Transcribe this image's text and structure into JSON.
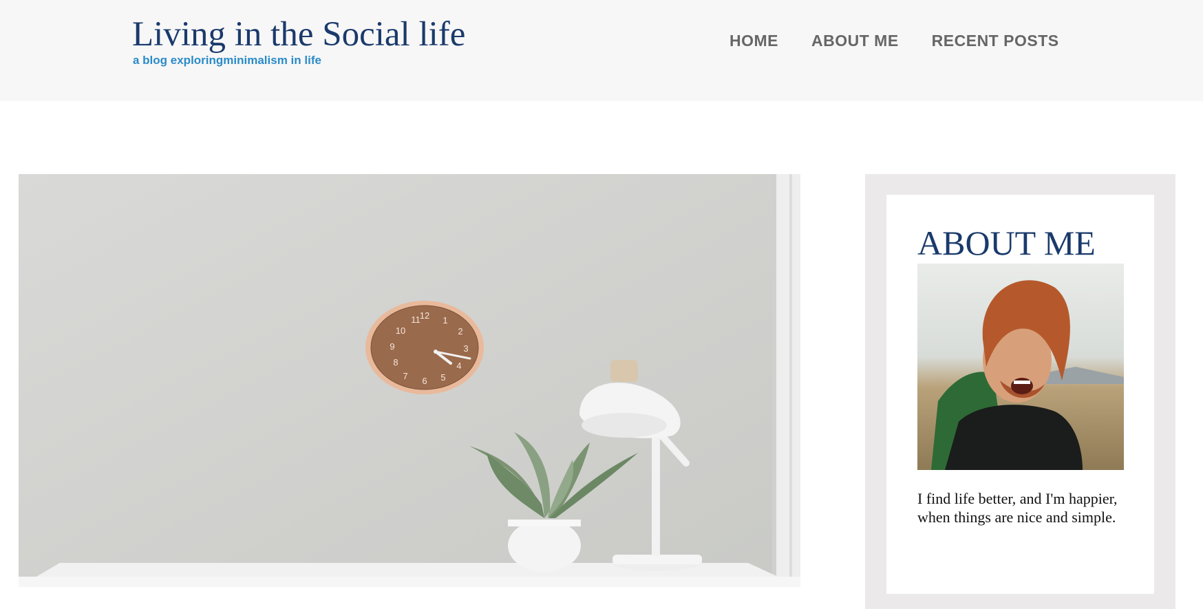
{
  "site": {
    "title": "Living in the Social life",
    "tagline": "a blog exploringminimalism in life"
  },
  "nav": {
    "items": [
      {
        "label": "HOME"
      },
      {
        "label": "ABOUT ME"
      },
      {
        "label": "RECENT POSTS"
      }
    ]
  },
  "hero": {
    "clock_numbers": [
      "12",
      "1",
      "2",
      "3",
      "4",
      "5",
      "6",
      "7",
      "8",
      "9",
      "10",
      "11"
    ]
  },
  "about": {
    "title": "ABOUT ME",
    "text": "I find life better, and I'm happier, when things are nice and simple."
  },
  "colors": {
    "title": "#1a3a6b",
    "tagline": "#2a8bc9",
    "nav": "#666666",
    "header_bg": "#f7f7f7",
    "sidebar_frame": "#ebe9ea"
  }
}
